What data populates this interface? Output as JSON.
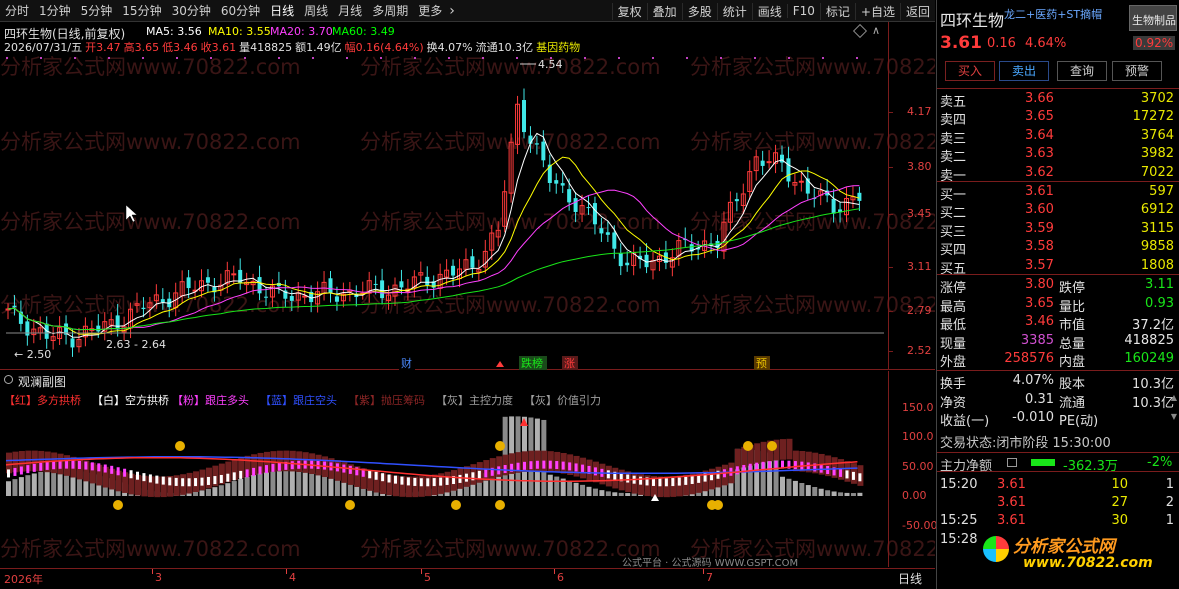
{
  "toolbar": {
    "periods": [
      "分时",
      "1分钟",
      "5分钟",
      "15分钟",
      "30分钟",
      "60分钟",
      "日线",
      "周线",
      "月线",
      "多周期",
      "更多"
    ],
    "active_period": "日线",
    "more_chevron": "chevron-right-icon",
    "actions": [
      "复权",
      "叠加",
      "多股",
      "统计",
      "画线",
      "F10",
      "标记",
      "+自选",
      "返回"
    ]
  },
  "main_chart": {
    "title": "四环生物(日线,前复权)",
    "ma": [
      {
        "label": "MA5: 3.56",
        "color": "#ffffff"
      },
      {
        "label": "MA10: 3.55",
        "color": "#ffff00"
      },
      {
        "label": "MA20: 3.70",
        "color": "#ff40ff"
      },
      {
        "label": "MA60: 3.49",
        "color": "#00ff00"
      }
    ],
    "info_line": {
      "date": "2026/07/31/五",
      "open": "开3.47",
      "high": "高3.65",
      "low": "低3.46",
      "close": "收3.61",
      "volume": "量418825",
      "amount": "额1.49亿",
      "change": "幅0.16(4.64%)",
      "turnover": "换4.07%",
      "float": "流通10.3亿",
      "concept": "基因药物"
    },
    "price_axis": [
      "4.17",
      "3.80",
      "3.45",
      "3.11",
      "2.79",
      "2.52"
    ],
    "high_marker": "4.54",
    "low_marker": "2.50",
    "range_label": "2.63 - 2.64",
    "event_tags": [
      "财",
      "跌榜",
      "涨",
      "预"
    ],
    "watermark": "分析家公式网www.70822.com"
  },
  "sub_chart": {
    "title": "观澜副图",
    "legend": [
      {
        "text": "【红】多方拱桥",
        "color": "#ff3030"
      },
      {
        "text": "【白】空方拱桥",
        "color": "#ffffff"
      },
      {
        "text": "【粉】跟庄多头",
        "color": "#ff40ff"
      },
      {
        "text": "【蓝】跟庄空头",
        "color": "#3050ff"
      },
      {
        "text": "【紫】抛压筹码",
        "color": "#8b2525"
      },
      {
        "text": "【灰】主控力度",
        "color": "#a0a0a0"
      },
      {
        "text": "【灰】价值引力",
        "color": "#a0a0a0"
      }
    ],
    "axis": [
      "150.0",
      "100.0",
      "50.00",
      "0.00",
      "-50.00"
    ],
    "footer_text": "公式平台 · 公式源码 WWW.GSPT.COM"
  },
  "time_axis": {
    "labels": [
      "2026年",
      "3",
      "4",
      "5",
      "6",
      "7"
    ],
    "period_label": "日线"
  },
  "quote": {
    "name": "四环生物",
    "tags": "龙二+医药+ST摘帽",
    "sector": "生物制品",
    "sector_change": "0.92%",
    "price": "3.61",
    "change": "0.16",
    "change_pct": "4.64%",
    "buttons": [
      "买入",
      "卖出",
      "查询",
      "预警"
    ],
    "asks": [
      {
        "label": "卖五",
        "price": "3.66",
        "vol": "3702"
      },
      {
        "label": "卖四",
        "price": "3.65",
        "vol": "17272"
      },
      {
        "label": "卖三",
        "price": "3.64",
        "vol": "3764"
      },
      {
        "label": "卖二",
        "price": "3.63",
        "vol": "3982"
      },
      {
        "label": "卖一",
        "price": "3.62",
        "vol": "7022"
      }
    ],
    "bids": [
      {
        "label": "买一",
        "price": "3.61",
        "vol": "597"
      },
      {
        "label": "买二",
        "price": "3.60",
        "vol": "6912"
      },
      {
        "label": "买三",
        "price": "3.59",
        "vol": "3115"
      },
      {
        "label": "买四",
        "price": "3.58",
        "vol": "9858"
      },
      {
        "label": "买五",
        "price": "3.57",
        "vol": "1808"
      }
    ],
    "stats": [
      {
        "l1": "涨停",
        "v1": "3.80",
        "c1": "#ff3b3b",
        "l2": "跌停",
        "v2": "3.11",
        "c2": "#19e619"
      },
      {
        "l1": "最高",
        "v1": "3.65",
        "c1": "#ff3b3b",
        "l2": "量比",
        "v2": "0.93",
        "c2": "#19e619"
      },
      {
        "l1": "最低",
        "v1": "3.46",
        "c1": "#ff3b3b",
        "l2": "市值",
        "v2": "37.2亿",
        "c2": "#e6e6e6"
      },
      {
        "l1": "现量",
        "v1": "3385",
        "c1": "#d050d0",
        "l2": "总量",
        "v2": "418825",
        "c2": "#e6e6e6"
      },
      {
        "l1": "外盘",
        "v1": "258576",
        "c1": "#ff3b3b",
        "l2": "内盘",
        "v2": "160249",
        "c2": "#19e619"
      }
    ],
    "stats2": [
      {
        "l1": "换手",
        "v1": "4.07%",
        "l2": "股本",
        "v2": "10.3亿"
      },
      {
        "l1": "净资",
        "v1": "0.31",
        "l2": "流通",
        "v2": "10.3亿"
      },
      {
        "l1": "收益(一)",
        "v1": "-0.010",
        "l2": "PE(动)",
        "v2": ""
      }
    ],
    "status_label": "交易状态:",
    "status_value": "闭市阶段",
    "status_time": "15:30:00",
    "main_flow_label": "主力净额",
    "main_flow_value": "-362.3万",
    "main_flow_pct": "-2%",
    "ticks": [
      {
        "time": "15:20",
        "price": "3.61",
        "vol": "10",
        "n": "1"
      },
      {
        "time": "",
        "price": "3.61",
        "vol": "27",
        "n": "2"
      },
      {
        "time": "15:25",
        "price": "3.61",
        "vol": "30",
        "n": "1"
      },
      {
        "time": "15:28",
        "price": "",
        "vol": "",
        "n": ""
      }
    ],
    "logo_text": "分析家公式网",
    "logo_url": "www.70822.com"
  }
}
